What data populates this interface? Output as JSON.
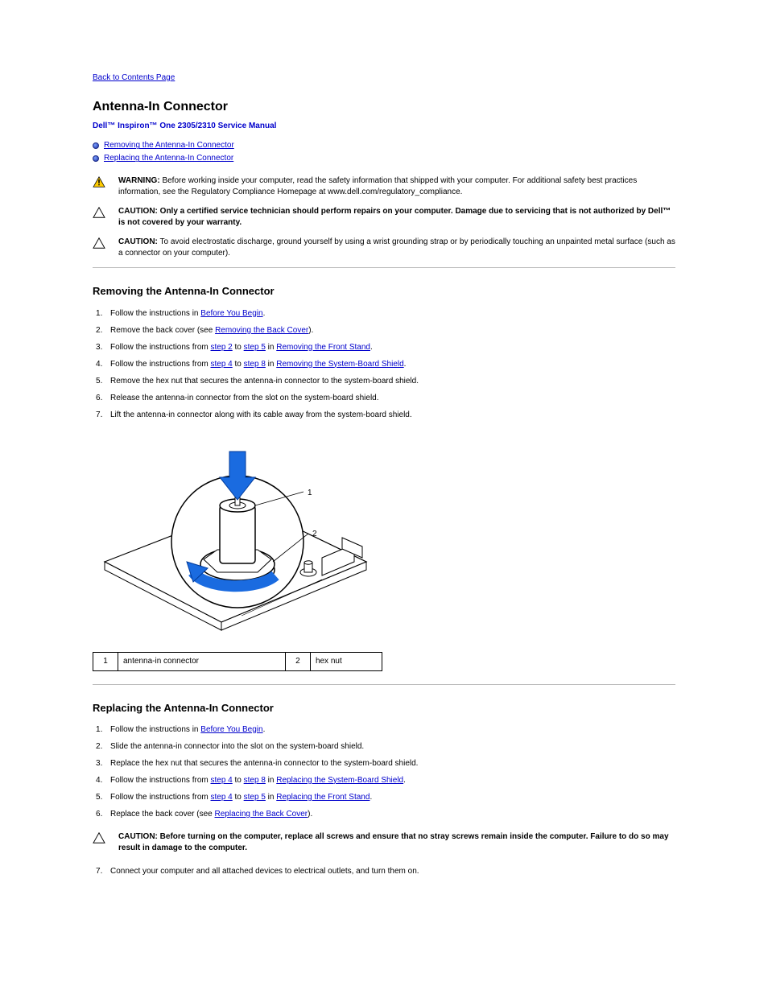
{
  "back_link": "Back to Contents Page",
  "title": "Antenna-In Connector",
  "subtitle": "Dell™ Inspiron™ One 2305/2310 Service Manual",
  "toc": [
    "Removing the Antenna-In Connector",
    "Replacing the Antenna-In Connector"
  ],
  "alerts": {
    "warning": {
      "label": "WARNING:",
      "text": "Before working inside your computer, read the safety information that shipped with your computer. For additional safety best practices information, see the Regulatory Compliance Homepage at www.dell.com/regulatory_compliance."
    },
    "caution1": {
      "label": "CAUTION:",
      "text_before": "",
      "text_bold": "Only a certified service technician should perform repairs on your computer. Damage due to servicing that is not authorized by Dell™ is not covered by your warranty."
    },
    "caution2": {
      "label": "CAUTION:",
      "text": "To avoid electrostatic discharge, ground yourself by using a wrist grounding strap or by periodically touching an unpainted metal surface (such as a connector on your computer)."
    }
  },
  "section1": {
    "heading": "Removing the Antenna-In Connector",
    "steps": [
      {
        "text": "Follow the instructions in ",
        "link": "Before You Begin",
        "after": "."
      },
      {
        "text": "Remove the back cover (see ",
        "link": "Removing the Back Cover",
        "after": ")."
      },
      {
        "text": "Follow the instructions from ",
        "link1": "step 2",
        "mid1": " to ",
        "link2": "step 5",
        "mid2": " in ",
        "link3": "Removing the Front Stand",
        "after": "."
      },
      {
        "text": "Follow the instructions from ",
        "link1": "step 4",
        "mid1": " to ",
        "link2": "step 8",
        "mid2": " in ",
        "link3": "Removing the System-Board Shield",
        "after": "."
      },
      {
        "text": "Remove the hex nut that secures the antenna-in connector to the system-board shield."
      },
      {
        "text": "Release the antenna-in connector from the slot on the system-board shield."
      },
      {
        "text": "Lift the antenna-in connector along with its cable away from the system-board shield."
      }
    ]
  },
  "legend": [
    {
      "num": "1",
      "label": "antenna-in connector"
    },
    {
      "num": "2",
      "label": "hex nut"
    }
  ],
  "section2": {
    "heading": "Replacing the Antenna-In Connector",
    "steps_a": [
      {
        "text": "Follow the instructions in ",
        "link": "Before You Begin",
        "after": "."
      },
      {
        "text": "Slide the antenna-in connector into the slot on the system-board shield."
      },
      {
        "text": "Replace the hex nut that secures the antenna-in connector to the system-board shield."
      },
      {
        "text": "Follow the instructions from ",
        "link1": "step 4",
        "mid1": " to ",
        "link2": "step 8",
        "mid2": " in ",
        "link3": "Replacing the System-Board Shield",
        "after": "."
      },
      {
        "text": "Follow the instructions from ",
        "link1": "step 4",
        "mid1": " to ",
        "link2": "step 5",
        "mid2": " in ",
        "link3": "Replacing the Front Stand",
        "after": "."
      },
      {
        "text": "Replace the back cover (see ",
        "link": "Replacing the Back Cover",
        "after": ")."
      }
    ],
    "caution": {
      "label": "CAUTION:",
      "text": "Before turning on the computer, replace all screws and ensure that no stray screws remain inside the computer. Failure to do so may result in damage to the computer."
    },
    "steps_b": [
      {
        "text": "Connect your computer and all attached devices to electrical outlets, and turn them on."
      }
    ]
  }
}
